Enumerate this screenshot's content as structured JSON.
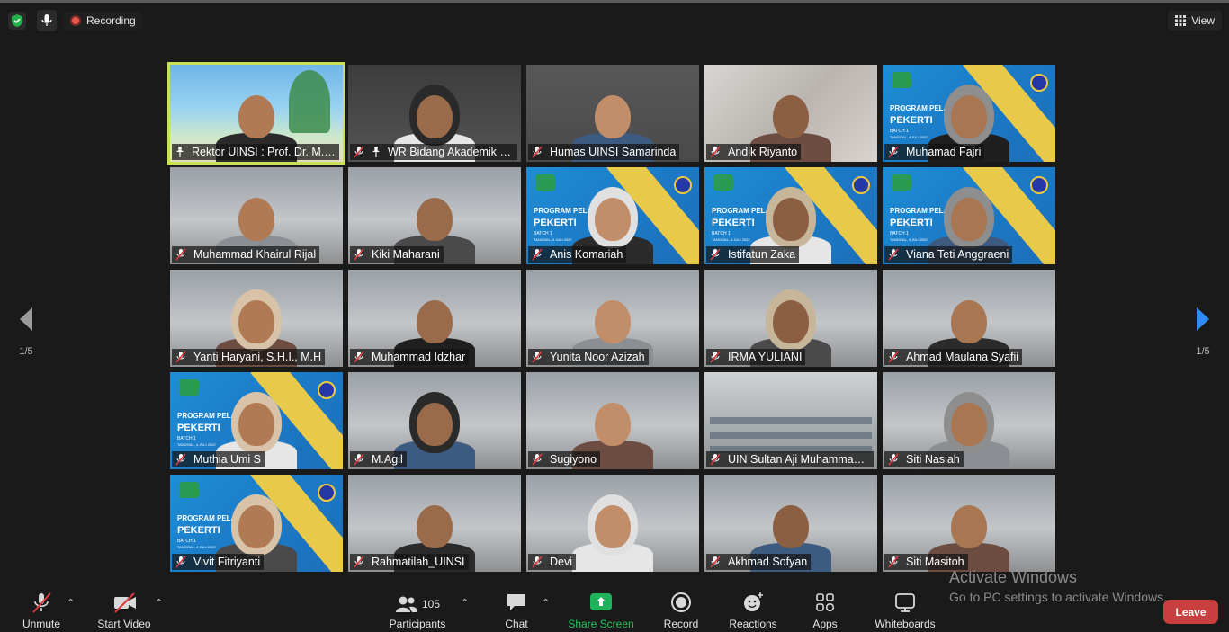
{
  "topbar": {
    "recording_label": "Recording",
    "view_label": "View"
  },
  "participants": [
    {
      "name": "Rektor UINSI : Prof. Dr. M. ...",
      "pinned": true,
      "active": true,
      "scene": "beach"
    },
    {
      "name": "WR Bidang Akademik U...",
      "pinned": true,
      "active": false,
      "scene": "portrait"
    },
    {
      "name": "Humas UINSI Samarinda",
      "pinned": false,
      "active": false,
      "scene": "library"
    },
    {
      "name": "Andik Riyanto",
      "pinned": false,
      "active": false,
      "scene": "wall"
    },
    {
      "name": "Muhamad Fajri",
      "pinned": false,
      "active": false,
      "scene": "banner"
    },
    {
      "name": "Muhammad Khairul Rijal",
      "pinned": false,
      "active": false,
      "scene": "room"
    },
    {
      "name": "Kiki Maharani",
      "pinned": false,
      "active": false,
      "scene": "room"
    },
    {
      "name": "Anis Komariah",
      "pinned": false,
      "active": false,
      "scene": "banner"
    },
    {
      "name": "Istifatun Zaka",
      "pinned": false,
      "active": false,
      "scene": "banner"
    },
    {
      "name": "Viana Teti Anggraeni",
      "pinned": false,
      "active": false,
      "scene": "banner"
    },
    {
      "name": "Yanti Haryani, S.H.I., M.H",
      "pinned": false,
      "active": false,
      "scene": "room"
    },
    {
      "name": "Muhammad Idzhar",
      "pinned": false,
      "active": false,
      "scene": "room"
    },
    {
      "name": "Yunita Noor Azizah",
      "pinned": false,
      "active": false,
      "scene": "room"
    },
    {
      "name": "IRMA YULIANI",
      "pinned": false,
      "active": false,
      "scene": "room"
    },
    {
      "name": "Ahmad Maulana Syafii",
      "pinned": false,
      "active": false,
      "scene": "room"
    },
    {
      "name": "Muthia Umi S",
      "pinned": false,
      "active": false,
      "scene": "banner"
    },
    {
      "name": "M.Agil",
      "pinned": false,
      "active": false,
      "scene": "room"
    },
    {
      "name": "Sugiyono",
      "pinned": false,
      "active": false,
      "scene": "room"
    },
    {
      "name": "UIN Sultan Aji Muhammad ...",
      "pinned": false,
      "active": false,
      "scene": "classroom"
    },
    {
      "name": "Siti Nasiah",
      "pinned": false,
      "active": false,
      "scene": "room"
    },
    {
      "name": "Vivit Fitriyanti",
      "pinned": false,
      "active": false,
      "scene": "banner"
    },
    {
      "name": "Rahmatilah_UINSI",
      "pinned": false,
      "active": false,
      "scene": "room"
    },
    {
      "name": "Devi",
      "pinned": false,
      "active": false,
      "scene": "room"
    },
    {
      "name": "Akhmad Sofyan",
      "pinned": false,
      "active": false,
      "scene": "room"
    },
    {
      "name": "Siti Masitoh",
      "pinned": false,
      "active": false,
      "scene": "room"
    }
  ],
  "banner_text": {
    "line1": "PROGRAM PELATIHAN",
    "line2": "PEKERTI",
    "line3": "BATCH 1",
    "line4": "TANGGAL, 4 JULI 2022"
  },
  "pagination": {
    "left": "1/5",
    "right": "1/5"
  },
  "toolbar": {
    "unmute": "Unmute",
    "start_video": "Start Video",
    "participants_count": "105",
    "participants": "Participants",
    "chat": "Chat",
    "share_screen": "Share Screen",
    "record": "Record",
    "reactions": "Reactions",
    "apps": "Apps",
    "whiteboards": "Whiteboards",
    "leave": "Leave"
  },
  "watermark": {
    "line1": "Activate Windows",
    "line2": "Go to PC settings to activate Windows."
  },
  "colors": {
    "background": "#1a1a1a",
    "active_speaker": "#c8e05a",
    "leave": "#c93e3e",
    "share_screen": "#1fb25a",
    "mic_off": "#e0383e"
  }
}
